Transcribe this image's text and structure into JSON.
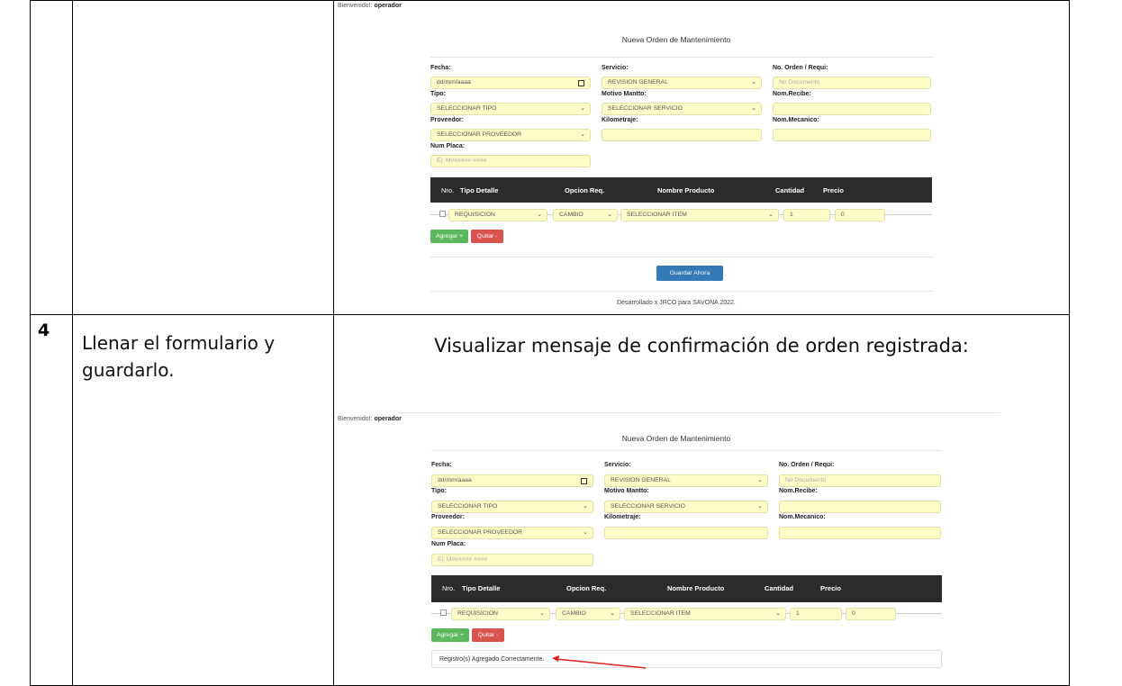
{
  "rows": [
    {
      "number": "",
      "description": "",
      "heading": ""
    },
    {
      "number": "4",
      "description": "Llenar el formulario y guardarlo.",
      "heading": "Visualizar mensaje de confirmación de orden registrada:"
    }
  ],
  "app": {
    "welcome_label": "Bienvenido!:",
    "welcome_user": "operador",
    "form_title": "Nueva Orden de Mantenimiento",
    "fields": {
      "fecha_label": "Fecha:",
      "fecha_placeholder": "dd/mm/aaaa",
      "servicio_label": "Servicio:",
      "servicio_value": "REVISION GENERAL",
      "orden_label": "No. Orden / Requi:",
      "orden_placeholder": "No Documento",
      "tipo_label": "Tipo:",
      "tipo_value": "SELECCIONAR TIPO",
      "motivo_label": "Motivo Mantto:",
      "motivo_value": "SELECCIONAR SERVICIO",
      "recibe_label": "Nom.Recibe:",
      "proveedor_label": "Proveedor:",
      "proveedor_value": "SELECCIONAR PROVEEDOR",
      "kilometraje_label": "Kilometraje:",
      "mecanico_label": "Nom.Mecanico:",
      "placa_label": "Num Placa:",
      "placa_placeholder": "Ej: M###### ####"
    },
    "table_headers": [
      "Nro.",
      "Tipo Detalle",
      "Opcion Req.",
      "Nombre Producto",
      "Cantidad",
      "Precio"
    ],
    "detail_row": {
      "tipo": "REQUISICION",
      "opcion": "CAMBIO",
      "producto": "SELECCIONAR ITEM",
      "cantidad": "1",
      "precio": "0"
    },
    "add_button": "Agregar +",
    "remove_button": "Quitar -",
    "save_button": "Guardar Ahora",
    "footer": "Desarrollado x JRCO para SAVONA 2022.",
    "success_message": "Registro(s) Agregado Correctamente."
  }
}
